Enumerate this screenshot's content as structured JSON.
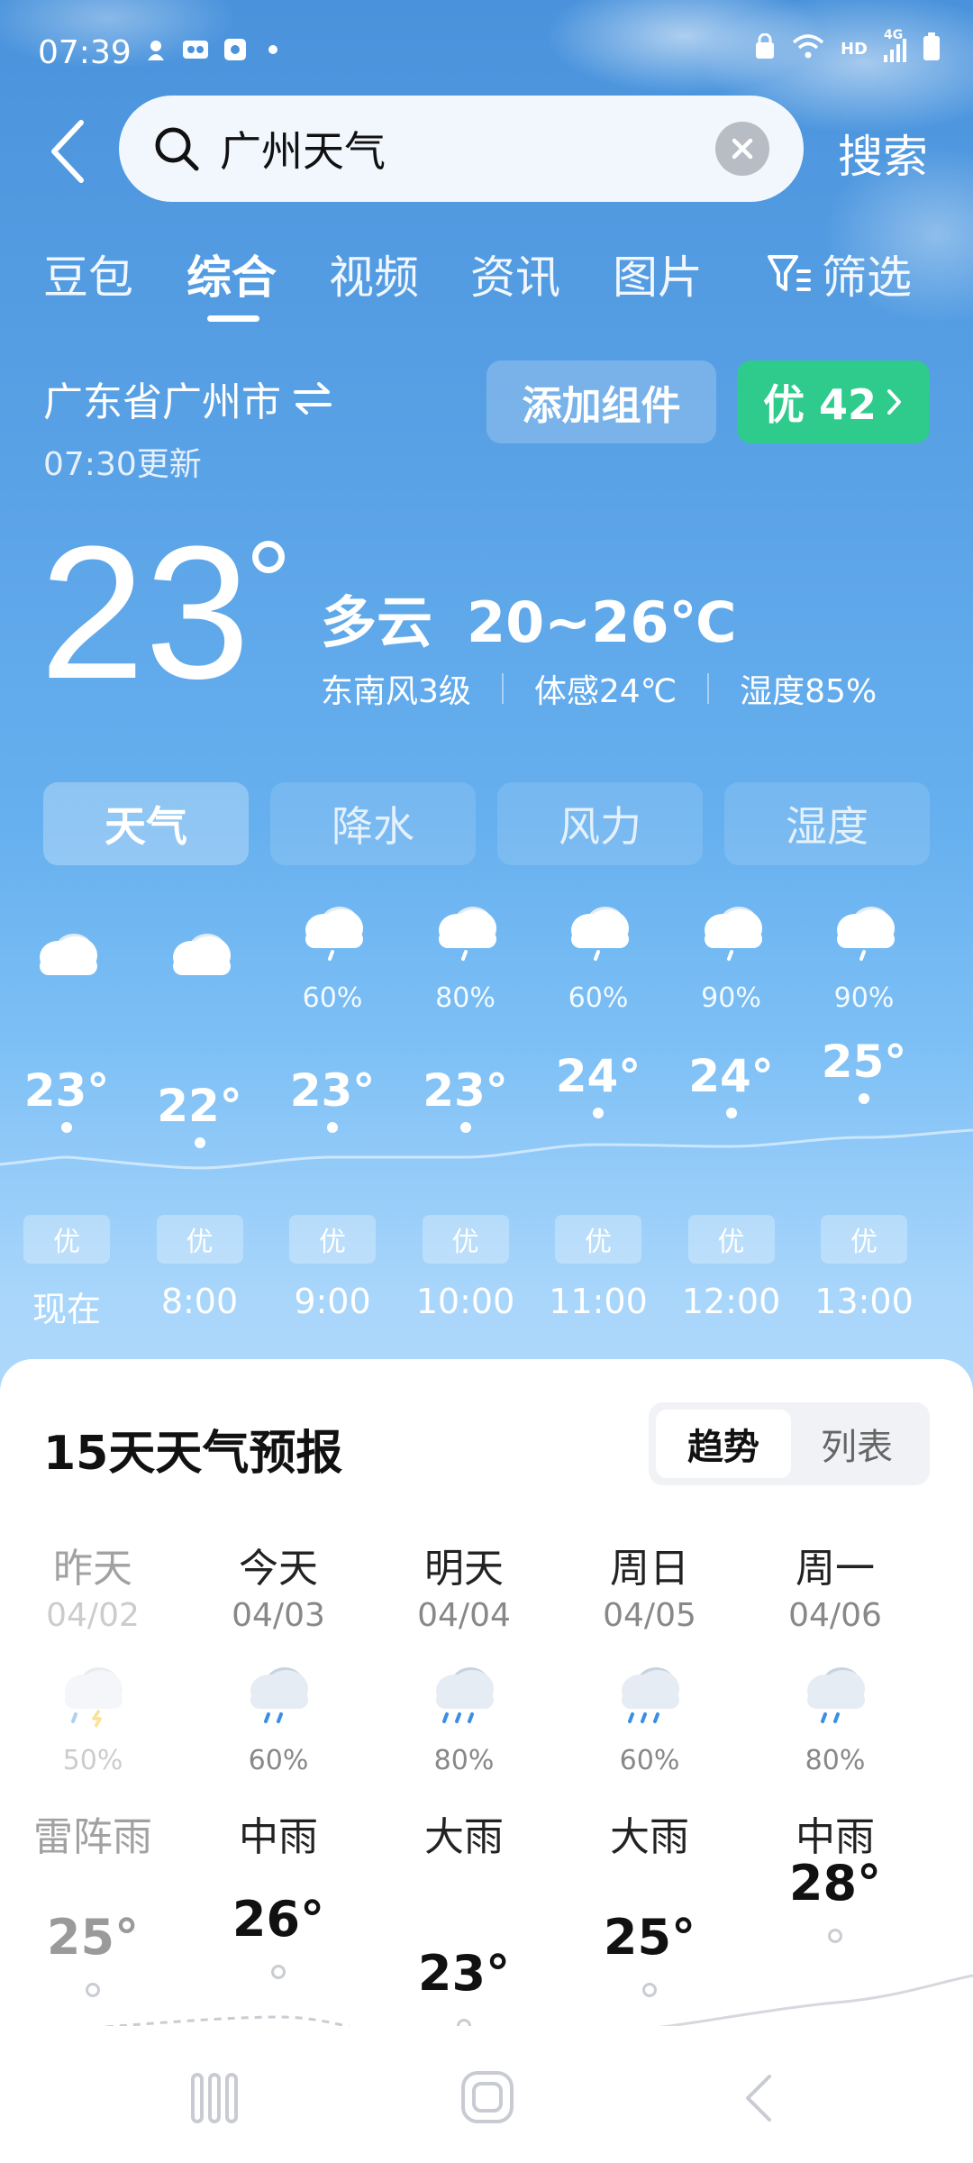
{
  "status_bar": {
    "time": "07:39",
    "network": "HD",
    "signal_label": "4G"
  },
  "search": {
    "query": "广州天气",
    "submit_label": "搜索"
  },
  "tabs": [
    "豆包",
    "综合",
    "视频",
    "资讯",
    "图片",
    "筛选"
  ],
  "active_tab": "综合",
  "location": {
    "name": "广东省广州市",
    "update_time": "07:30更新"
  },
  "actions": {
    "add_widget": "添加组件",
    "aqi_label": "优 42"
  },
  "current": {
    "temperature": "23",
    "condition": "多云",
    "range": "20~26℃",
    "wind": "东南风3级",
    "feels_like": "体感24℃",
    "humidity": "湿度85%"
  },
  "mode_tabs": [
    "天气",
    "降水",
    "风力",
    "湿度"
  ],
  "active_mode": "天气",
  "hourly": [
    {
      "time": "现在",
      "icon": "cloudy-icon",
      "precip": "",
      "temp": "23°",
      "aqi": "优"
    },
    {
      "time": "8:00",
      "icon": "cloudy-icon",
      "precip": "",
      "temp": "22°",
      "aqi": "优"
    },
    {
      "time": "9:00",
      "icon": "rain-icon",
      "precip": "60%",
      "temp": "23°",
      "aqi": "优"
    },
    {
      "time": "10:00",
      "icon": "rain-icon",
      "precip": "80%",
      "temp": "23°",
      "aqi": "优"
    },
    {
      "time": "11:00",
      "icon": "rain-icon",
      "precip": "60%",
      "temp": "24°",
      "aqi": "优"
    },
    {
      "time": "12:00",
      "icon": "rain-icon",
      "precip": "90%",
      "temp": "24°",
      "aqi": "优"
    },
    {
      "time": "13:00",
      "icon": "rain-icon",
      "precip": "90%",
      "temp": "25°",
      "aqi": "优"
    }
  ],
  "forecast": {
    "title": "15天天气预报",
    "view_toggle": [
      "趋势",
      "列表"
    ],
    "active_view": "趋势",
    "days": [
      {
        "name": "昨天",
        "date": "04/02",
        "icon": "thunder-rain-icon",
        "precip": "50%",
        "condition": "雷阵雨",
        "temp": "25°"
      },
      {
        "name": "今天",
        "date": "04/03",
        "icon": "moderate-rain-icon",
        "precip": "60%",
        "condition": "中雨",
        "temp": "26°"
      },
      {
        "name": "明天",
        "date": "04/04",
        "icon": "heavy-rain-icon",
        "precip": "80%",
        "condition": "大雨",
        "temp": "23°"
      },
      {
        "name": "周日",
        "date": "04/05",
        "icon": "heavy-rain-icon",
        "precip": "60%",
        "condition": "大雨",
        "temp": "25°"
      },
      {
        "name": "周一",
        "date": "04/06",
        "icon": "moderate-rain-icon",
        "precip": "80%",
        "condition": "中雨",
        "temp": "28°"
      }
    ]
  },
  "colors": {
    "aqi_good": "#2ecb8c",
    "sky_top": "#4a93dc"
  }
}
